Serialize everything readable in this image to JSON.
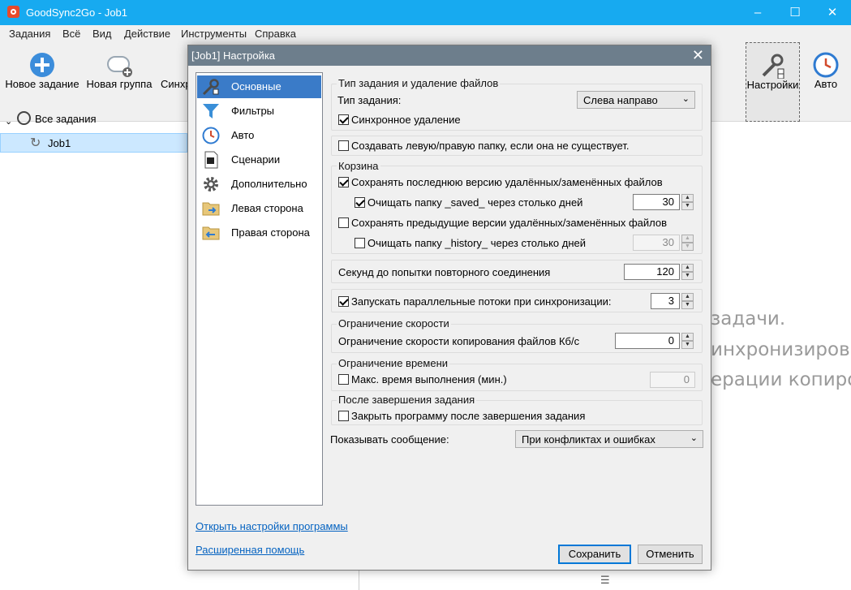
{
  "window": {
    "title": "GoodSync2Go - Job1",
    "minimize": "–",
    "maximize": "☐",
    "close": "✕"
  },
  "menu": [
    "Задания",
    "Всё",
    "Вид",
    "Действие",
    "Инструменты",
    "Справка"
  ],
  "toolbar": {
    "new_job": "Новое задание",
    "new_group": "Новая группа",
    "sync": "Синхр",
    "settings": "Настройки",
    "auto": "Авто"
  },
  "tree": {
    "all_jobs": "Все задания",
    "job": "Job1"
  },
  "background_text": [
    "задачи.",
    "инхронизиров",
    "ерации копиро"
  ],
  "dialog": {
    "title": "[Job1] Настройка",
    "close": "✕",
    "nav": [
      {
        "label": "Основные",
        "icon": "wrench-icon"
      },
      {
        "label": "Фильтры",
        "icon": "funnel-icon"
      },
      {
        "label": "Авто",
        "icon": "clock-icon"
      },
      {
        "label": "Сценарии",
        "icon": "script-icon"
      },
      {
        "label": "Дополнительно",
        "icon": "gear-icon"
      },
      {
        "label": "Левая сторона",
        "icon": "folder-left-icon"
      },
      {
        "label": "Правая сторона",
        "icon": "folder-right-icon"
      }
    ],
    "job_type_group": "Тип задания и удаление файлов",
    "job_type_label": "Тип задания:",
    "job_type_value": "Слева направо",
    "sync_delete": "Синхронное удаление",
    "create_folder": "Создавать левую/правую папку, если она не существует.",
    "recycle_group": "Корзина",
    "keep_last": "Сохранять последнюю версию удалённых/заменённых файлов",
    "clean_saved": "Очищать папку _saved_ через столько дней",
    "clean_saved_days": "30",
    "keep_prev": "Сохранять предыдущие версии удалённых/заменённых файлов",
    "clean_history": "Очищать папку _history_ через столько дней",
    "clean_history_days": "30",
    "retry_label": "Секунд до попытки повторного соединения",
    "retry_value": "120",
    "parallel_label": "Запускать параллельные потоки при синхронизации:",
    "parallel_value": "3",
    "speed_group": "Ограничение скорости",
    "speed_label": "Ограничение скорости копирования файлов Кб/с",
    "speed_value": "0",
    "time_group": "Ограничение времени",
    "time_label": "Макс. время выполнения (мин.)",
    "time_value": "0",
    "after_group": "После завершения задания",
    "close_after": "Закрыть программу после завершения задания",
    "show_msg_label": "Показывать сообщение:",
    "show_msg_value": "При конфликтах и ошибках",
    "link_settings": "Открыть настройки программы",
    "link_help": "Расширенная помощь",
    "save": "Сохранить",
    "cancel": "Отменить"
  },
  "checks": {
    "sync_delete": true,
    "create_folder": false,
    "keep_last": true,
    "clean_saved": true,
    "keep_prev": false,
    "clean_history": false,
    "parallel": true,
    "time": false,
    "close_after": false
  }
}
